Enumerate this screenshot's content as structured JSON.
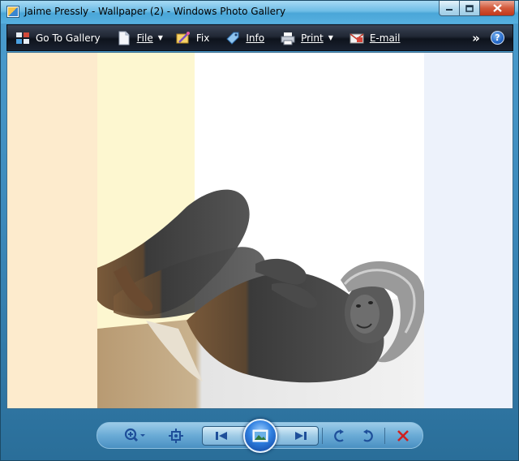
{
  "window": {
    "title": "Jaime Pressly - Wallpaper (2) - Windows Photo Gallery"
  },
  "toolbar": {
    "go_to_gallery": "Go To Gallery",
    "file": "File",
    "fix": "Fix",
    "info": "Info",
    "print": "Print",
    "email": "E-mail",
    "more": "»",
    "help": "?"
  },
  "colors": {
    "toolbar_bg": "#1a2130",
    "viewer_bg": "#eef2fa",
    "close_button": "#c2371a",
    "slideshow_button": "#2f7fe0",
    "delete_icon": "#d02020"
  },
  "controls": {
    "zoom": "zoom-icon",
    "actual_size": "fit-window-icon",
    "previous": "previous-icon",
    "slideshow": "slideshow-icon",
    "next": "next-icon",
    "rotate_left": "rotate-counterclockwise-icon",
    "rotate_right": "rotate-clockwise-icon",
    "delete": "delete-icon"
  }
}
